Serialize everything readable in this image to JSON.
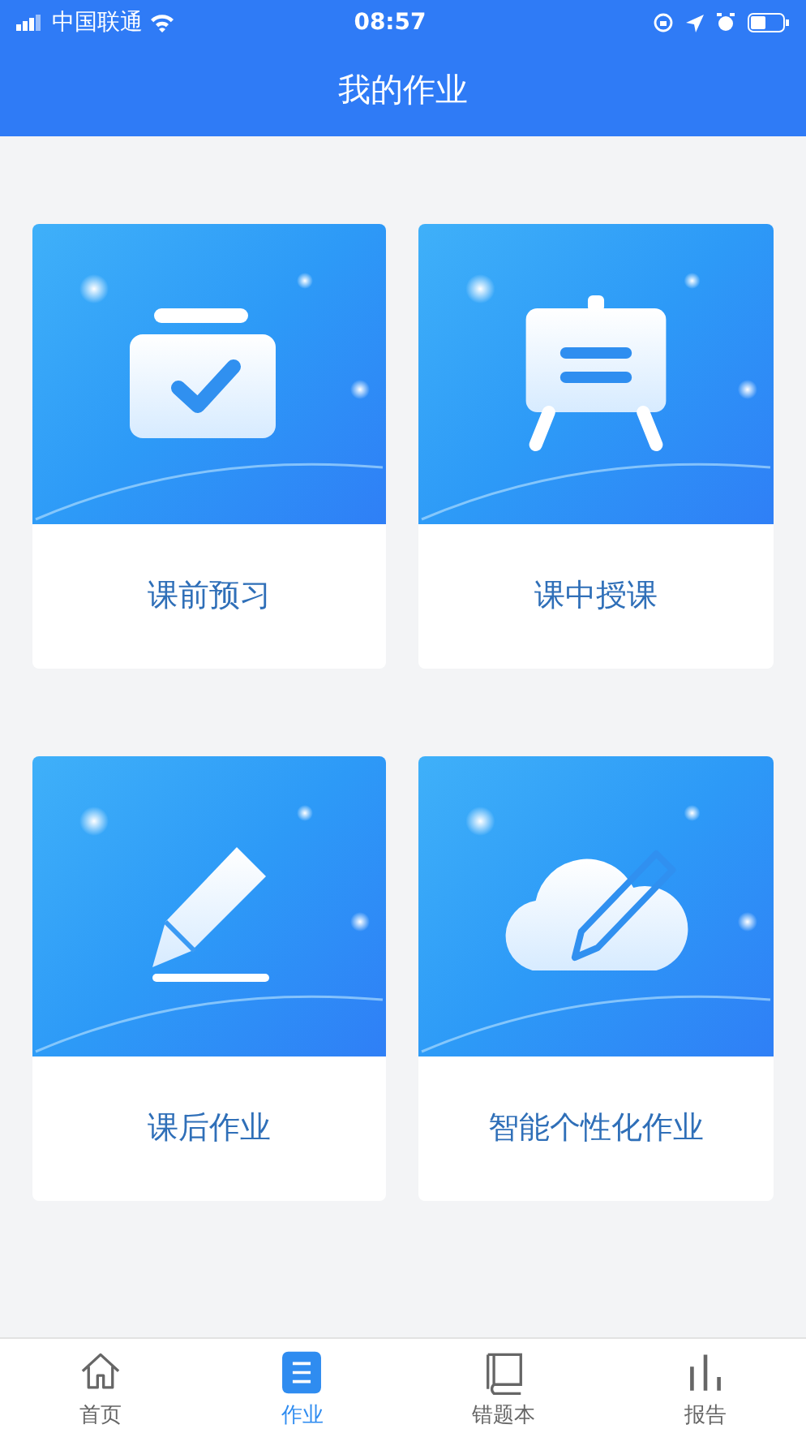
{
  "status_bar": {
    "carrier": "中国联通",
    "time": "08:57"
  },
  "header": {
    "title": "我的作业"
  },
  "cards": [
    {
      "kind": "check",
      "label": "课前预习"
    },
    {
      "kind": "board",
      "label": "课中授课"
    },
    {
      "kind": "pencil",
      "label": "课后作业"
    },
    {
      "kind": "cloud",
      "label": "智能个性化作业"
    }
  ],
  "tab_bar": [
    {
      "kind": "home",
      "label": "首页",
      "selected": false
    },
    {
      "kind": "list",
      "label": "作业",
      "selected": true
    },
    {
      "kind": "book",
      "label": "错题本",
      "selected": false
    },
    {
      "kind": "report",
      "label": "报告",
      "selected": false
    }
  ]
}
